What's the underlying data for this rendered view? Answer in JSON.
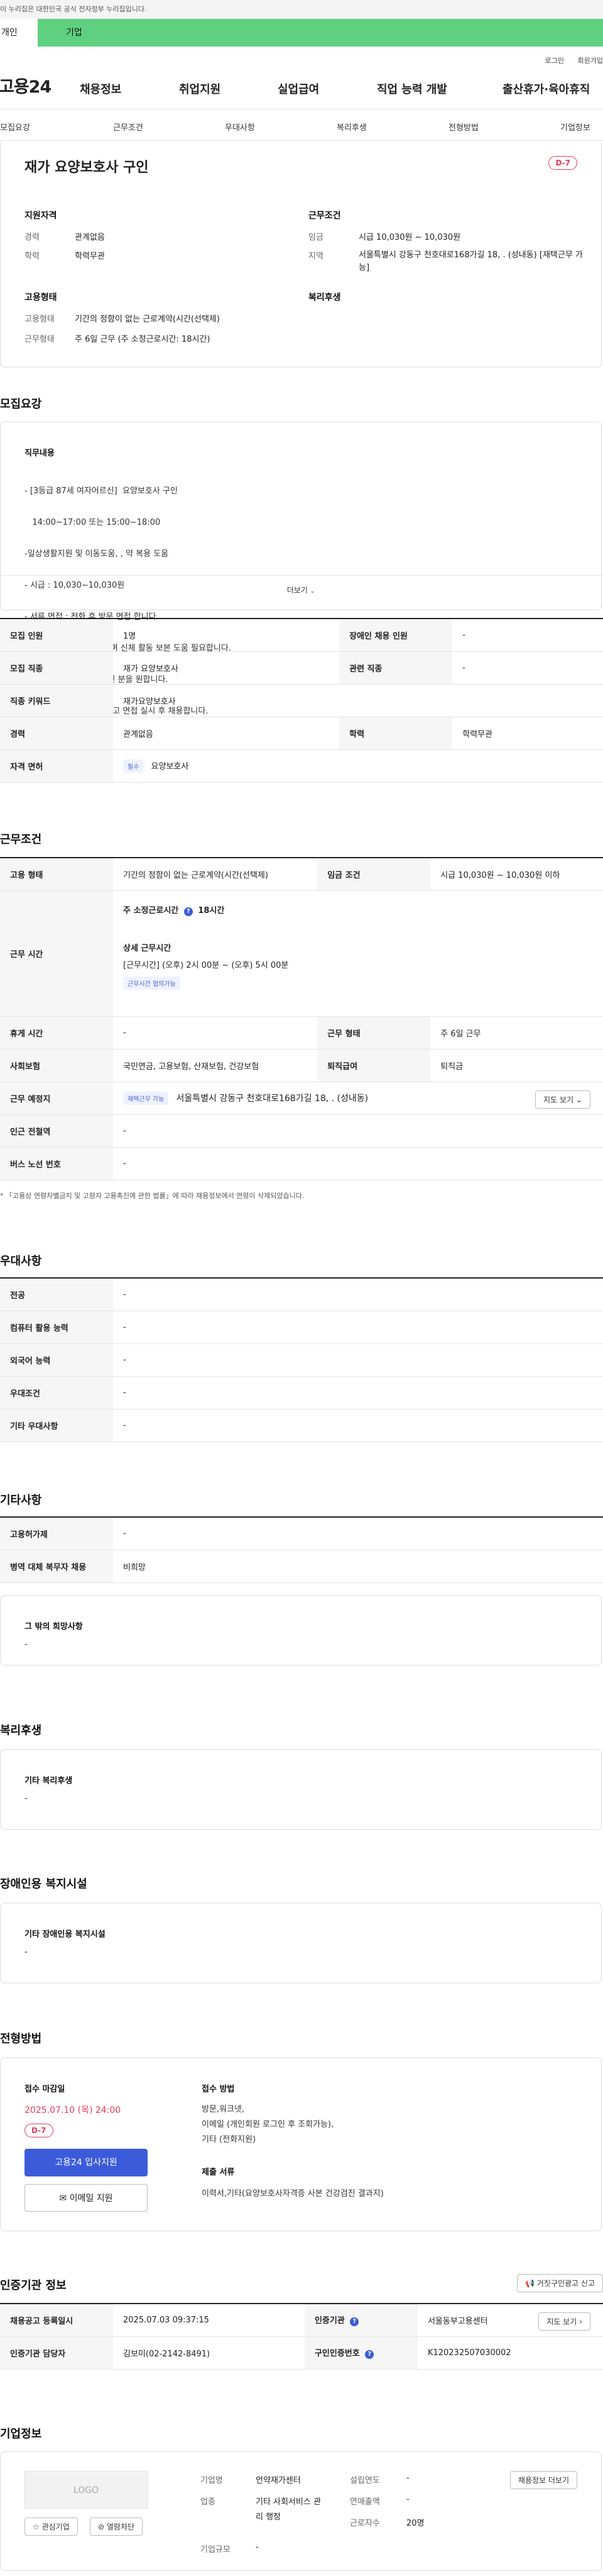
{
  "gov_bar": "이 누리집은 대한민국 공식 전자정부 누리집입니다.",
  "tabs": {
    "personal": "개인",
    "company": "기업"
  },
  "util": {
    "login": "로그인",
    "join": "회원가입"
  },
  "gnb": {
    "logo": "고용24",
    "items": [
      "채용정보",
      "취업지원",
      "실업급여",
      "직업 능력 개발",
      "출산휴가·육아휴직"
    ]
  },
  "subnav": [
    "모집요강",
    "근무조건",
    "우대사항",
    "복리후생",
    "전형방법",
    "기업정보"
  ],
  "summary": {
    "title": "재가 요양보호사 구인",
    "dday": "D-7",
    "qual_head": "지원자격",
    "career_label": "경력",
    "career": "관계없음",
    "edu_label": "학력",
    "edu": "학력무관",
    "cond_head": "근무조건",
    "wage_label": "임금",
    "wage": "시급 10,030원 ~ 10,030원",
    "area_label": "지역",
    "area": "서울특별시 강동구 천호대로168가길 18, . (성내동) [재택근무 가능]",
    "emp_head": "고용형태",
    "emptype_label": "고용형태",
    "emptype": "기간의 정함이 없는 근로계약(시간(선택제)",
    "worktype_label": "근무형태",
    "worktype": "주 6일 근무 (주 소정근로시간: 18시간)",
    "welfare_head": "복리후생"
  },
  "recruit": {
    "section": "모집요강",
    "duty_head": "직무내용",
    "duty_lines": [
      "- [3등급 87세 여자어르신]  요양보호사 구인",
      "   14:00~17:00 또는 15:00~18:00",
      "-일상생활지원 및 이동도움, , 약 복용 도움",
      "- 시급 : 10,030~10,030원",
      "- 서류,면접 : 전화 후 방문 면접 합니다.",
      "- 인지 좋으시고 조용하시며 신체 활동 보본 도움 필요합니다.",
      "   밝고 공감 능력이 있으신 분을 원합니다.",
      "   궁금하신 점은 전화주시고 면접 실시 후 채용합니다."
    ],
    "more": "더보기",
    "rows": {
      "count_l": "모집 인원",
      "count": "1명",
      "disabled_l": "장애인 채용 인원",
      "disabled": "-",
      "job_l": "모집 직종",
      "job": "재가 요양보호사",
      "rel_l": "관련 직종",
      "rel": "-",
      "kw_l": "직종 키워드",
      "kw": "재가요양보호사",
      "career_l": "경력",
      "career": "관계없음",
      "edu_l": "학력",
      "edu": "학력무관",
      "lic_l": "자격 면허",
      "lic_tag": "필수",
      "lic": "요양보호사"
    }
  },
  "work": {
    "section": "근무조건",
    "emp_l": "고용 형태",
    "emp": "기간의 정함이 없는 근로계약(시간(선택제)",
    "wage_l": "임금 조건",
    "wage": "시급 10,030원 ~ 10,030원 이하",
    "time_l": "근무 시간",
    "weekly": "주 소정근로시간",
    "weekly_val": "18시간",
    "detail_head": "상세 근무시간",
    "detail": "[근무시간] (오후) 2시 00분 ~ (오후) 5시 00분",
    "detail_tag": "근무시간 협의가능",
    "rest_l": "휴게 시간",
    "rest": "-",
    "form_l": "근무 형태",
    "form": "주 6일 근무",
    "ins_l": "사회보험",
    "ins": "국민연금, 고용보험, 산재보험, 건강보험",
    "sev_l": "퇴직급여",
    "sev": "퇴직금",
    "place_l": "근무 예정지",
    "place_tag": "재택근무 가능",
    "place": "서울특별시 강동구 천호대로168가길 18, . (성내동)",
    "map_btn": "지도 보기",
    "sub_l": "인근 전철역",
    "sub": "-",
    "bus_l": "버스 노선 번호",
    "bus": "-",
    "note": "* 「고용상 연령차별금지 및 고령자 고용촉진에 관한 법률」에 따라 채용정보에서 연령이 삭제되었습니다."
  },
  "pref": {
    "section": "우대사항",
    "major_l": "전공",
    "major": "-",
    "pc_l": "컴퓨터 활용 능력",
    "pc": "-",
    "lang_l": "외국어 능력",
    "lang": "-",
    "cond_l": "우대조건",
    "cond": "-",
    "etc_l": "기타 우대사항",
    "etc": "-"
  },
  "misc": {
    "section": "기타사항",
    "permit_l": "고용허가제",
    "permit": "-",
    "army_l": "병역 대체 복무자 채용",
    "army": "비희망",
    "other_head": "그 밖의 희망사항",
    "other": "-"
  },
  "welfare": {
    "section": "복리후생",
    "head": "기타 복리후생",
    "val": "-"
  },
  "disab": {
    "section": "장애인용 복지시설",
    "head": "기타 장애인용 복지시설",
    "val": "-"
  },
  "process": {
    "section": "전형방법",
    "deadline_head": "접수 마감일",
    "deadline": "2025.07.10 (목) 24:00",
    "dday": "D-7",
    "apply": "고용24 입사지원",
    "email": "이메일 지원",
    "method_head": "접수 방법",
    "method": [
      "방문,워크넷,",
      "이메일 (개인회원 로그인 후 조회가능),",
      "기타 (전화지원)"
    ],
    "docs_head": "제출 서류",
    "docs": "이력서,기타(요양보호사자격증 사본 건강검진 결과지)"
  },
  "cert": {
    "section": "인증기관 정보",
    "report_btn": "거짓구인광고 신고",
    "date_l": "채용공고 등록일시",
    "date": "2025.07.03 09:37:15",
    "org_l": "인증기관",
    "org": "서울동부고용센터",
    "map_btn": "지도 보기",
    "mgr_l": "인증기관 담당자",
    "mgr": "김보미(02-2142-8491)",
    "no_l": "구인인증번호",
    "no": "K120232507030002"
  },
  "company": {
    "section": "기업정보",
    "logo": "LOGO",
    "interest": "관심기업",
    "block": "열람차단",
    "name_l": "기업명",
    "name": "언약재가센터",
    "ind_l": "업종",
    "ind": "기타 사회서비스 관리 행정",
    "size_l": "기업규모",
    "size": "-",
    "year_l": "설립연도",
    "year": "-",
    "rev_l": "연매출액",
    "rev": "-",
    "emp_l": "근로자수",
    "emp": "20명",
    "more_btn": "채용정보 더보기"
  }
}
